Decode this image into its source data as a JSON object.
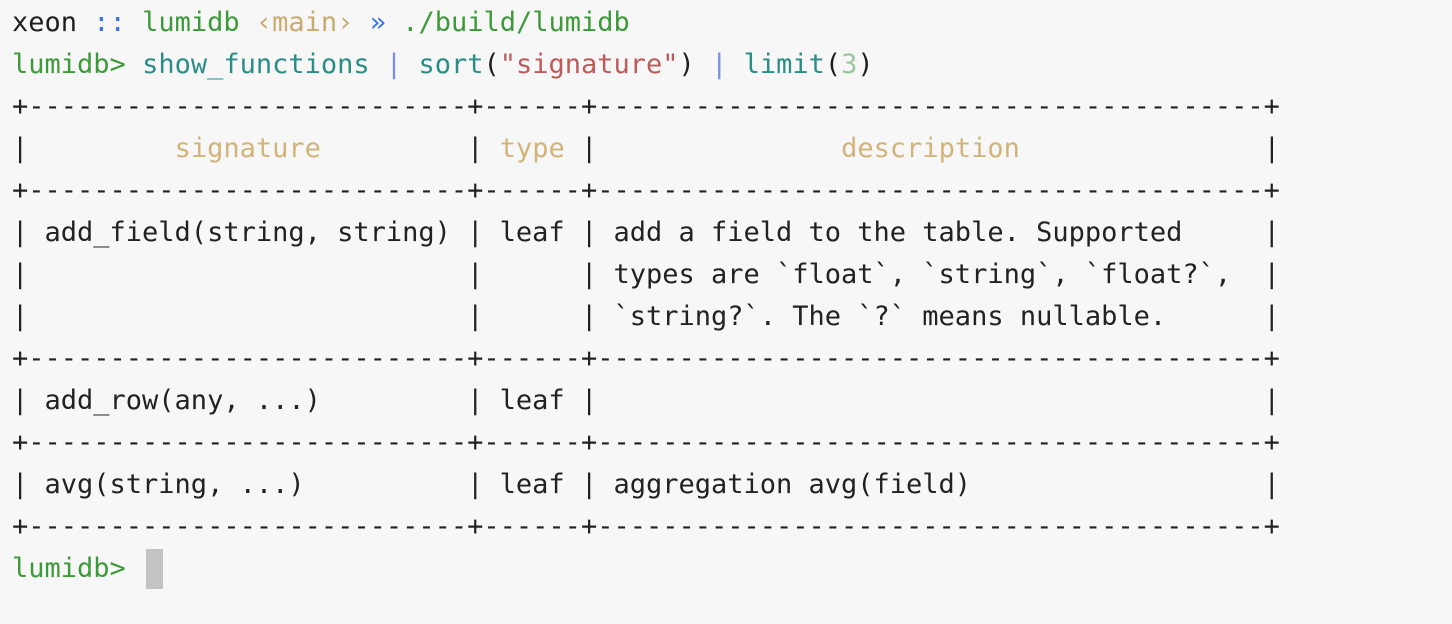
{
  "prompt_header": {
    "host": "xeon",
    "sep": "::",
    "dir": "lumidb",
    "branch": "‹main›",
    "arrow": "»",
    "command": "./build/lumidb"
  },
  "repl_command": {
    "prompt": "lumidb>",
    "fn1": "show_functions",
    "pipe1": "|",
    "fn2": "sort",
    "open2": "(",
    "arg2": "\"signature\"",
    "close2": ")",
    "pipe2": "|",
    "fn3": "limit",
    "open3": "(",
    "arg3": "3",
    "close3": ")"
  },
  "table": {
    "border": "+---------------------------+------+-----------------------------------------+",
    "headers": {
      "pre1": "|         ",
      "signature": "signature",
      "mid1": "         | ",
      "type": "type",
      "mid2": " |               ",
      "description": "description",
      "post": "               |"
    },
    "rows": [
      "| add_field(string, string) | leaf | add a field to the table. Supported     |",
      "|                           |      | types are `float`, `string`, `float?`,  |",
      "|                           |      | `string?`. The `?` means nullable.      |",
      "+---------------------------+------+-----------------------------------------+",
      "| add_row(any, ...)         | leaf |                                         |",
      "+---------------------------+------+-----------------------------------------+",
      "| avg(string, ...)          | leaf | aggregation avg(field)                  |"
    ]
  },
  "next_prompt": {
    "prompt": "lumidb>"
  }
}
